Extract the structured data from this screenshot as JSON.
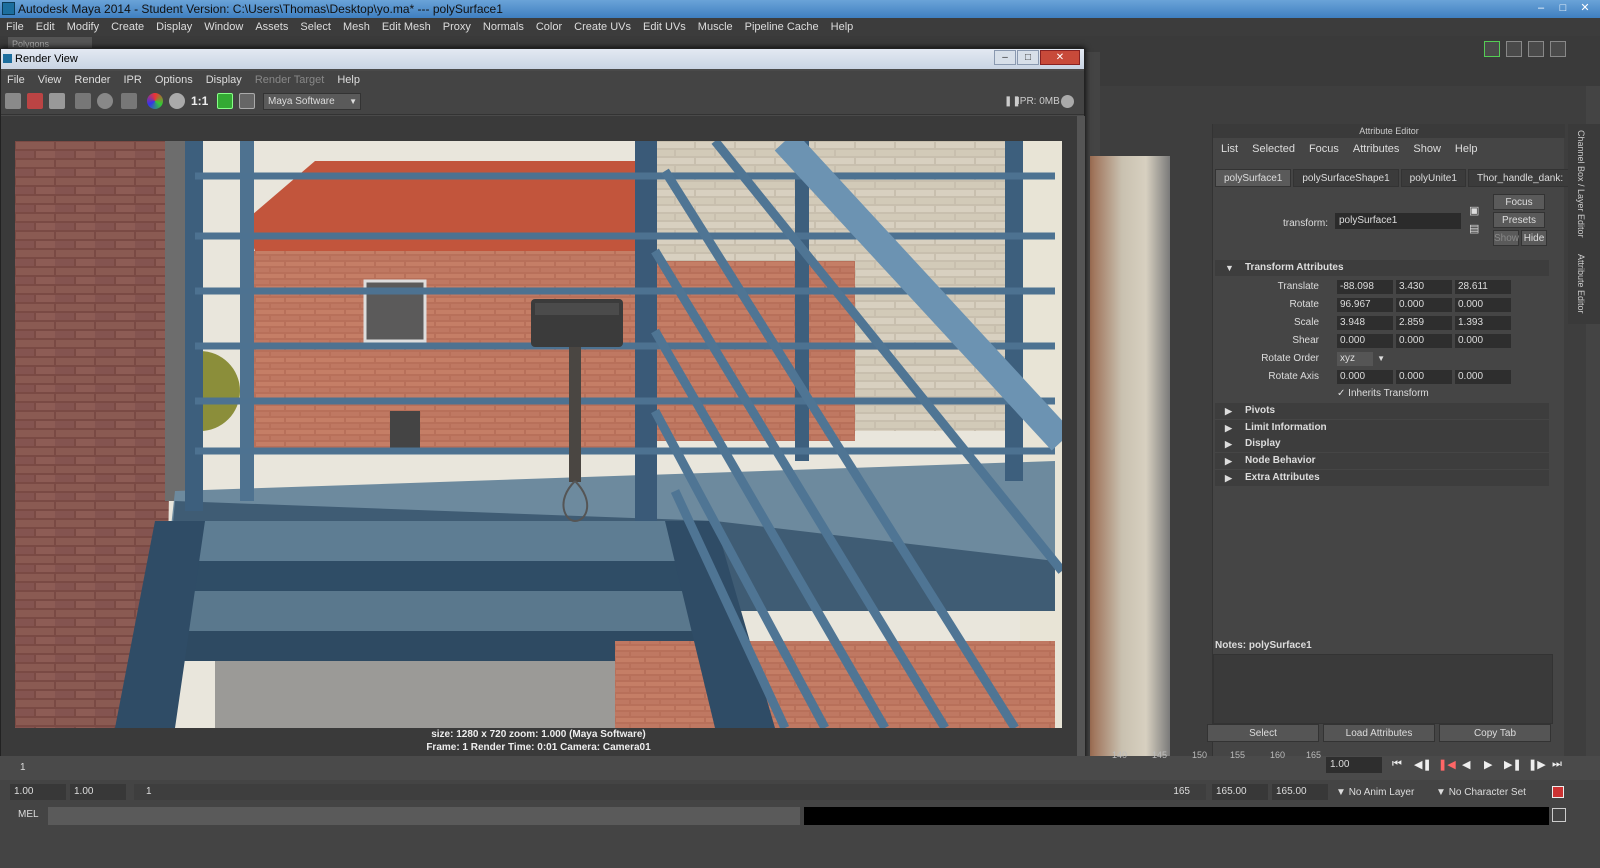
{
  "app_title": "Autodesk Maya 2014 - Student Version: C:\\Users\\Thomas\\Desktop\\yo.ma*   ---   polySurface1",
  "main_menu": [
    "File",
    "Edit",
    "Modify",
    "Create",
    "Display",
    "Window",
    "Assets",
    "Select",
    "Mesh",
    "Edit Mesh",
    "Proxy",
    "Normals",
    "Color",
    "Create UVs",
    "Edit UVs",
    "Muscle",
    "Pipeline Cache",
    "Help"
  ],
  "shelf_mode": "Polygons",
  "render_view": {
    "title": "Render View",
    "menu": [
      "File",
      "View",
      "Render",
      "IPR",
      "Options",
      "Display",
      "Render Target",
      "Help"
    ],
    "ratio_label": "1:1",
    "renderer": "Maya Software",
    "ipr_label": "IPR: 0MB",
    "info_line1": "size: 1280 x 720 zoom: 1.000        (Maya Software)",
    "info_line2": "Frame: 1        Render Time: 0:01        Camera: Camera01"
  },
  "attribute_editor": {
    "title": "Attribute Editor",
    "menu": [
      "List",
      "Selected",
      "Focus",
      "Attributes",
      "Show",
      "Help"
    ],
    "tabs": [
      "polySurface1",
      "polySurfaceShape1",
      "polyUnite1",
      "Thor_handle_dank:"
    ],
    "active_tab": 0,
    "focus_btn": "Focus",
    "presets_btn": "Presets",
    "show_btn": "Show",
    "hide_btn": "Hide",
    "transform_label": "transform:",
    "transform_value": "polySurface1",
    "section_transform": "Transform Attributes",
    "translate_label": "Translate",
    "translate": [
      "-88.098",
      "3.430",
      "28.611"
    ],
    "rotate_label": "Rotate",
    "rotate": [
      "96.967",
      "0.000",
      "0.000"
    ],
    "scale_label": "Scale",
    "scale": [
      "3.948",
      "2.859",
      "1.393"
    ],
    "shear_label": "Shear",
    "shear": [
      "0.000",
      "0.000",
      "0.000"
    ],
    "rotate_order_label": "Rotate Order",
    "rotate_order": "xyz",
    "rotate_axis_label": "Rotate Axis",
    "rotate_axis": [
      "0.000",
      "0.000",
      "0.000"
    ],
    "inherits_transform": "Inherits Transform",
    "sections": [
      "Pivots",
      "Limit Information",
      "Display",
      "Node Behavior",
      "Extra Attributes"
    ],
    "notes_label": "Notes:  polySurface1",
    "bottom_buttons": [
      "Select",
      "Load Attributes",
      "Copy Tab"
    ]
  },
  "side_tabs": [
    "Channel Box / Layer Editor",
    "Attribute Editor"
  ],
  "timeline": {
    "ticks": [
      "140",
      "145",
      "150",
      "155",
      "160",
      "165"
    ],
    "start_tick": "1",
    "current_frame": "1.00"
  },
  "range": {
    "start": "1.00",
    "start2": "1.00",
    "slider_start": "1",
    "slider_end": "165",
    "end": "165.00",
    "end2": "165.00",
    "anim_layer": "No Anim Layer",
    "char_set": "No Character Set"
  },
  "cmd": {
    "label": "MEL"
  }
}
